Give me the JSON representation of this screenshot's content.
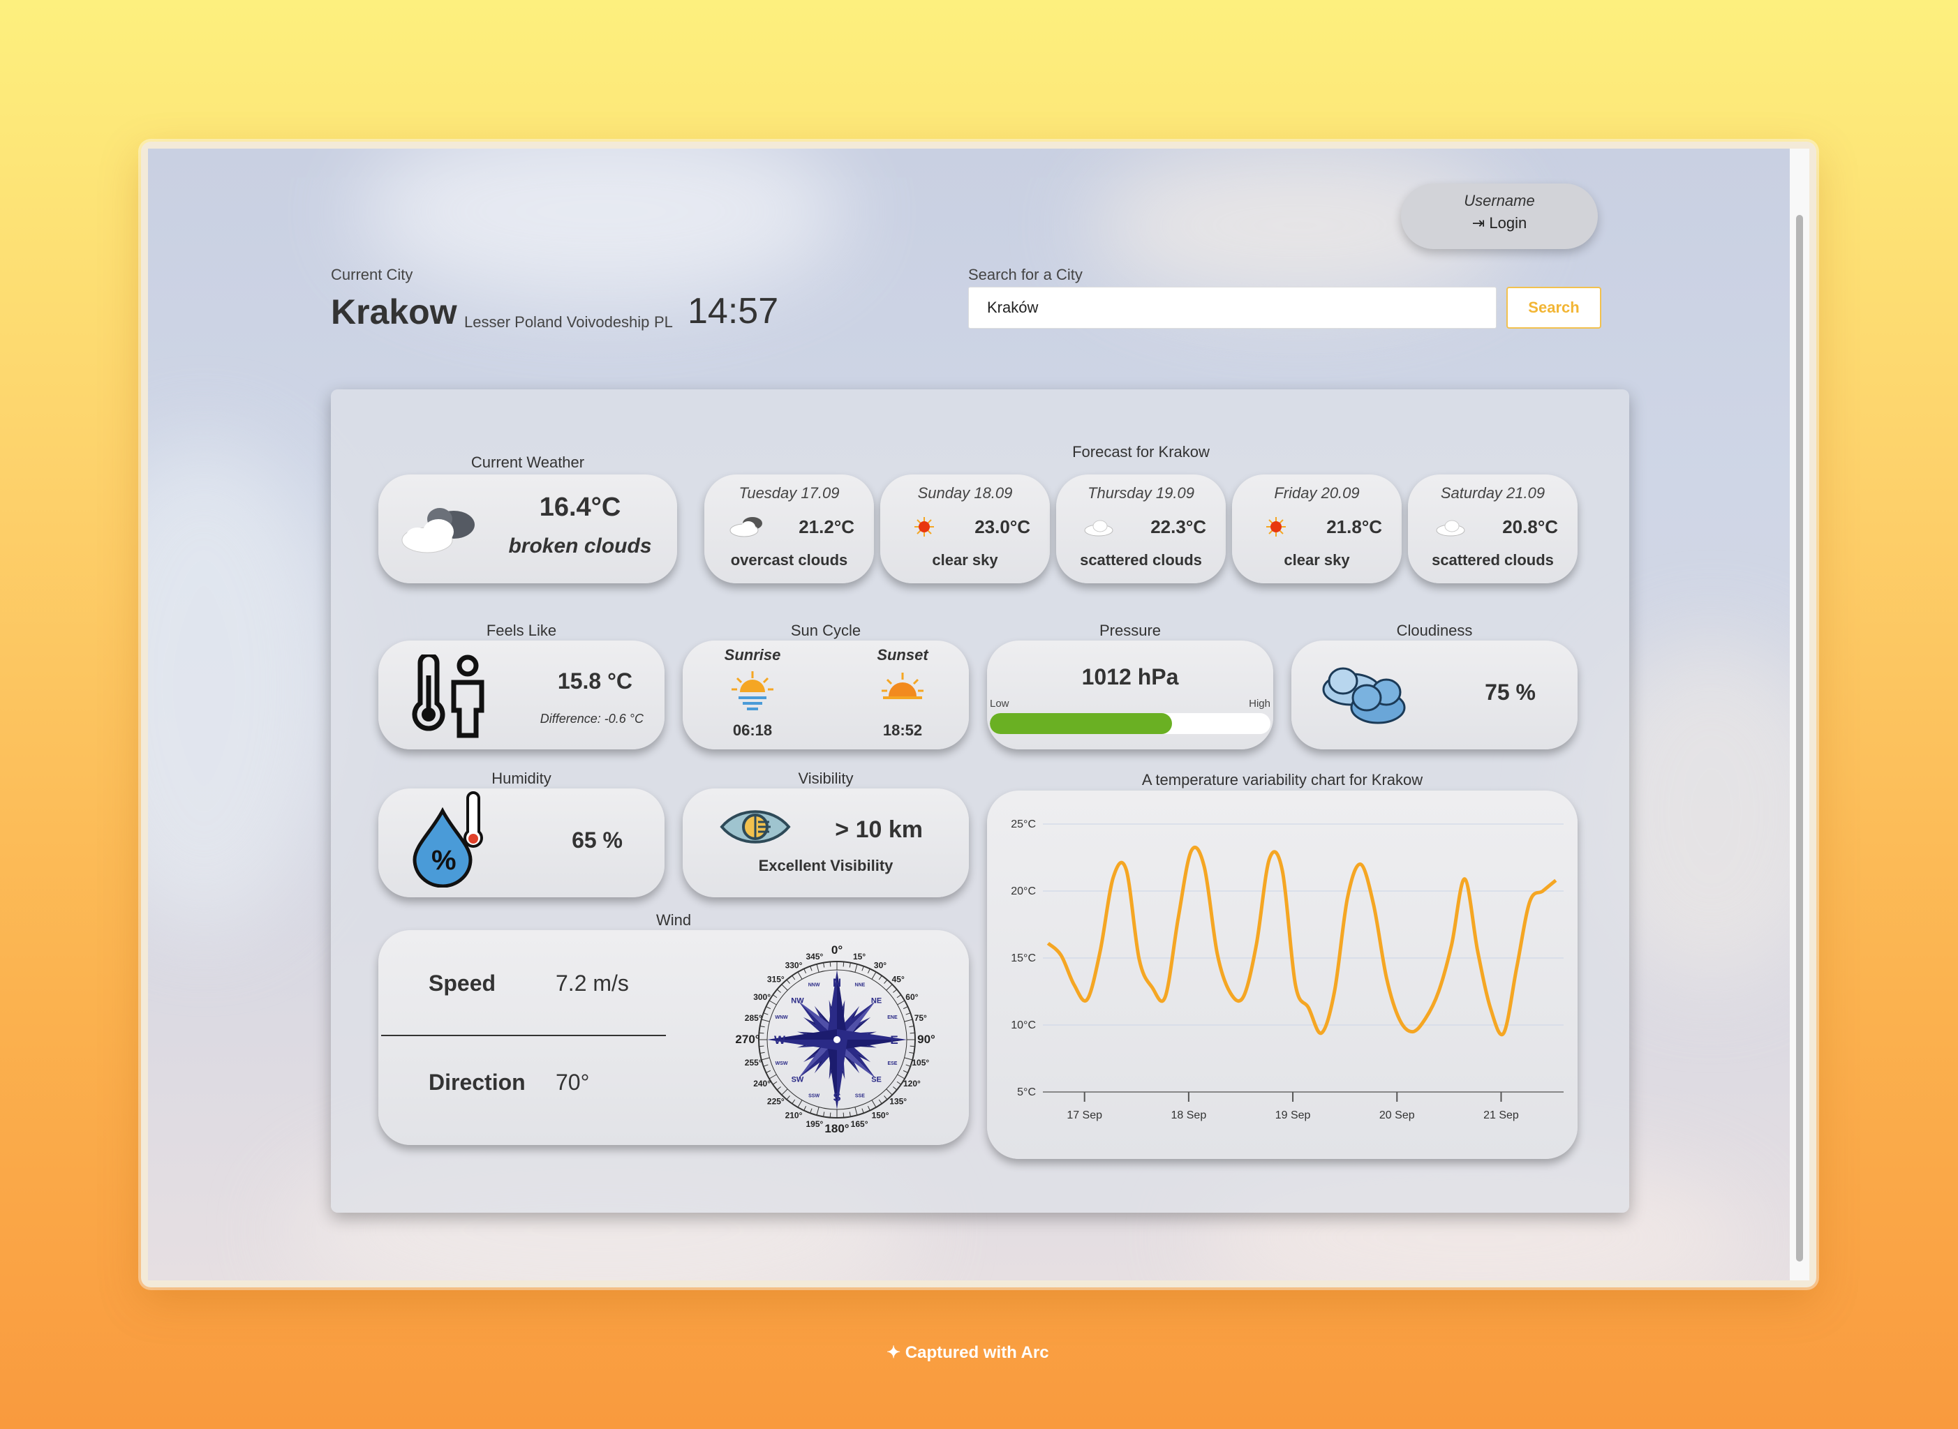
{
  "header": {
    "current_city_label": "Current City",
    "city": "Krakow",
    "region": "Lesser Poland Voivodeship",
    "country": "PL",
    "time": "14:57",
    "search_label": "Search for a City",
    "search_value": "Kraków",
    "search_button": "Search",
    "username": "Username",
    "login_label": "Login"
  },
  "current": {
    "title": "Current Weather",
    "temp": "16.4°C",
    "description": "broken clouds",
    "icon": "broken-clouds-icon"
  },
  "forecast": {
    "title": "Forecast for Krakow",
    "days": [
      {
        "day": "Tuesday 17.09",
        "temp": "21.2°C",
        "desc": "overcast clouds",
        "icon": "overcast-clouds-icon"
      },
      {
        "day": "Sunday 18.09",
        "temp": "23.0°C",
        "desc": "clear sky",
        "icon": "sun-icon"
      },
      {
        "day": "Thursday 19.09",
        "temp": "22.3°C",
        "desc": "scattered clouds",
        "icon": "cloud-icon"
      },
      {
        "day": "Friday 20.09",
        "temp": "21.8°C",
        "desc": "clear sky",
        "icon": "sun-icon"
      },
      {
        "day": "Saturday 21.09",
        "temp": "20.8°C",
        "desc": "scattered clouds",
        "icon": "cloud-icon"
      }
    ]
  },
  "feels_like": {
    "title": "Feels Like",
    "value": "15.8 °C",
    "difference": "Difference: -0.6 °C"
  },
  "sun_cycle": {
    "title": "Sun Cycle",
    "sunrise_label": "Sunrise",
    "sunrise": "06:18",
    "sunset_label": "Sunset",
    "sunset": "18:52"
  },
  "pressure": {
    "title": "Pressure",
    "value": "1012 hPa",
    "low_label": "Low",
    "high_label": "High",
    "level": 0.65,
    "bar_color": "#6ab023"
  },
  "cloudiness": {
    "title": "Cloudiness",
    "value": "75 %"
  },
  "humidity": {
    "title": "Humidity",
    "value": "65 %"
  },
  "visibility": {
    "title": "Visibility",
    "value": "> 10 km",
    "description": "Excellent Visibility"
  },
  "wind": {
    "title": "Wind",
    "speed_label": "Speed",
    "speed": "7.2 m/s",
    "direction_label": "Direction",
    "direction": "70°",
    "compass_cardinals": [
      "N",
      "E",
      "S",
      "W"
    ],
    "compass_intercardinals": [
      "NE",
      "SE",
      "SW",
      "NW"
    ],
    "compass_minor": [
      "NNE",
      "ENE",
      "ESE",
      "SSE",
      "SSW",
      "WSW",
      "WNW",
      "NNW"
    ],
    "compass_degrees": [
      "0°",
      "15°",
      "30°",
      "45°",
      "60°",
      "75°",
      "90°",
      "105°",
      "120°",
      "135°",
      "150°",
      "165°",
      "180°",
      "195°",
      "210°",
      "225°",
      "240°",
      "255°",
      "270°",
      "285°",
      "300°",
      "315°",
      "330°",
      "345°"
    ]
  },
  "chart_title": "A temperature variability chart for Krakow",
  "chart_data": {
    "type": "line",
    "title": "A temperature variability chart for Krakow",
    "line_color": "#f5a623",
    "ylim": [
      5,
      25
    ],
    "y_ticks": [
      5,
      10,
      15,
      20,
      25
    ],
    "y_tick_labels": [
      "5°C",
      "10°C",
      "15°C",
      "20°C",
      "25°C"
    ],
    "x_tick_labels": [
      "17 Sep",
      "18 Sep",
      "19 Sep",
      "20 Sep",
      "21 Sep"
    ],
    "x_ticks": [
      0.35,
      1.35,
      2.35,
      3.35,
      4.35
    ],
    "xlim": [
      -0.05,
      4.95
    ],
    "grid": true,
    "series": [
      {
        "x": [
          0,
          0.125,
          0.25,
          0.375,
          0.5,
          0.625,
          0.75,
          0.875,
          1,
          1.125,
          1.25,
          1.375,
          1.5,
          1.625,
          1.75,
          1.875,
          2,
          2.125,
          2.25,
          2.375,
          2.5,
          2.625,
          2.75,
          2.875,
          3,
          3.125,
          3.25,
          3.375,
          3.5,
          3.625,
          3.75,
          3.875,
          4,
          4.125,
          4.25,
          4.375,
          4.5,
          4.625,
          4.75,
          4.875
        ],
        "y": [
          16.1,
          15.2,
          13.0,
          11.9,
          15.5,
          21.0,
          21.6,
          14.9,
          12.8,
          12.1,
          18.0,
          23.0,
          21.8,
          15.3,
          12.4,
          12.1,
          16.0,
          22.4,
          21.5,
          13.0,
          11.3,
          9.4,
          12.5,
          19.5,
          22.0,
          19.0,
          13.5,
          10.4,
          9.5,
          10.5,
          12.5,
          16.0,
          20.9,
          15.5,
          11.2,
          9.4,
          14.3,
          19.2,
          20.0,
          20.8
        ]
      }
    ]
  }
}
